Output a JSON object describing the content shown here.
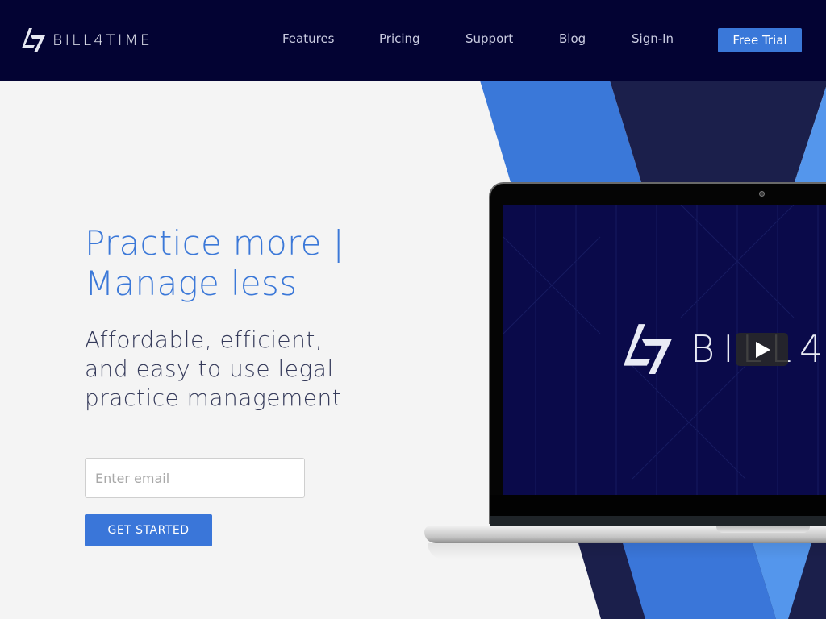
{
  "header": {
    "logo_text": "BILL4TIME",
    "nav": [
      {
        "label": "Features"
      },
      {
        "label": "Pricing"
      },
      {
        "label": "Support"
      },
      {
        "label": "Blog"
      },
      {
        "label": "Sign-In"
      }
    ],
    "cta_label": "Free Trial"
  },
  "hero": {
    "title_line1": "Practice more |",
    "title_line2": "Manage less",
    "subtitle_line1": "Affordable, efficient,",
    "subtitle_line2": "and easy to use legal",
    "subtitle_line3": "practice management",
    "email_placeholder": "Enter email",
    "email_value": "",
    "button_label": "GET STARTED"
  },
  "video": {
    "logo_text": "BILL4",
    "play_icon": "play-icon"
  },
  "colors": {
    "header_bg": "#030333",
    "accent_blue": "#3a78d9",
    "light_blue": "#5496ec",
    "navy": "#1b1f4b",
    "page_bg": "#f4f4f4"
  }
}
